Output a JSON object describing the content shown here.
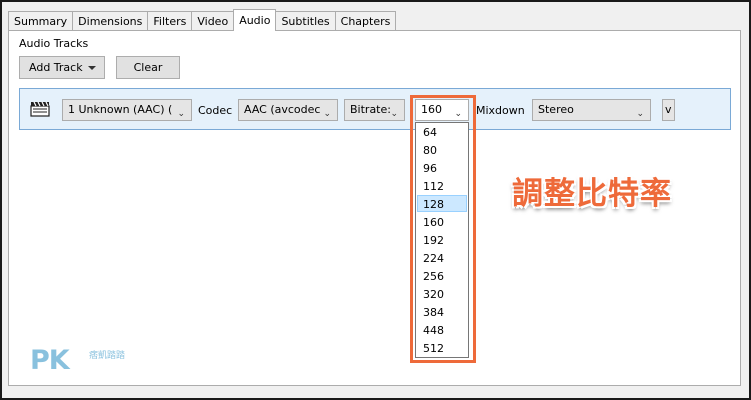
{
  "tabs": [
    {
      "label": "Summary",
      "active": false
    },
    {
      "label": "Dimensions",
      "active": false
    },
    {
      "label": "Filters",
      "active": false
    },
    {
      "label": "Video",
      "active": false
    },
    {
      "label": "Audio",
      "active": true
    },
    {
      "label": "Subtitles",
      "active": false
    },
    {
      "label": "Chapters",
      "active": false
    }
  ],
  "audio": {
    "section_title": "Audio Tracks",
    "add_track_label": "Add Track",
    "clear_label": "Clear"
  },
  "track": {
    "source": "1 Unknown (AAC) (",
    "codec_label": "Codec",
    "codec_value": "AAC (avcodec",
    "bitrate_mode": "Bitrate:",
    "bitrate_value": "160",
    "mixdown_label": "Mixdown",
    "mixdown_value": "Stereo",
    "extra_value": "v"
  },
  "bitrate_options": [
    "64",
    "80",
    "96",
    "112",
    "128",
    "160",
    "192",
    "224",
    "256",
    "320",
    "384",
    "448",
    "512"
  ],
  "bitrate_highlighted": "128",
  "annotation": {
    "callout": "調整比特率",
    "color": "#ee6a3a"
  },
  "watermark": {
    "logo": "PK",
    "sub": "痞凱踏踏"
  },
  "colors": {
    "row_background": "#e5f1fb",
    "row_border": "#7aa9d6",
    "selected_option": "#cce8ff"
  }
}
